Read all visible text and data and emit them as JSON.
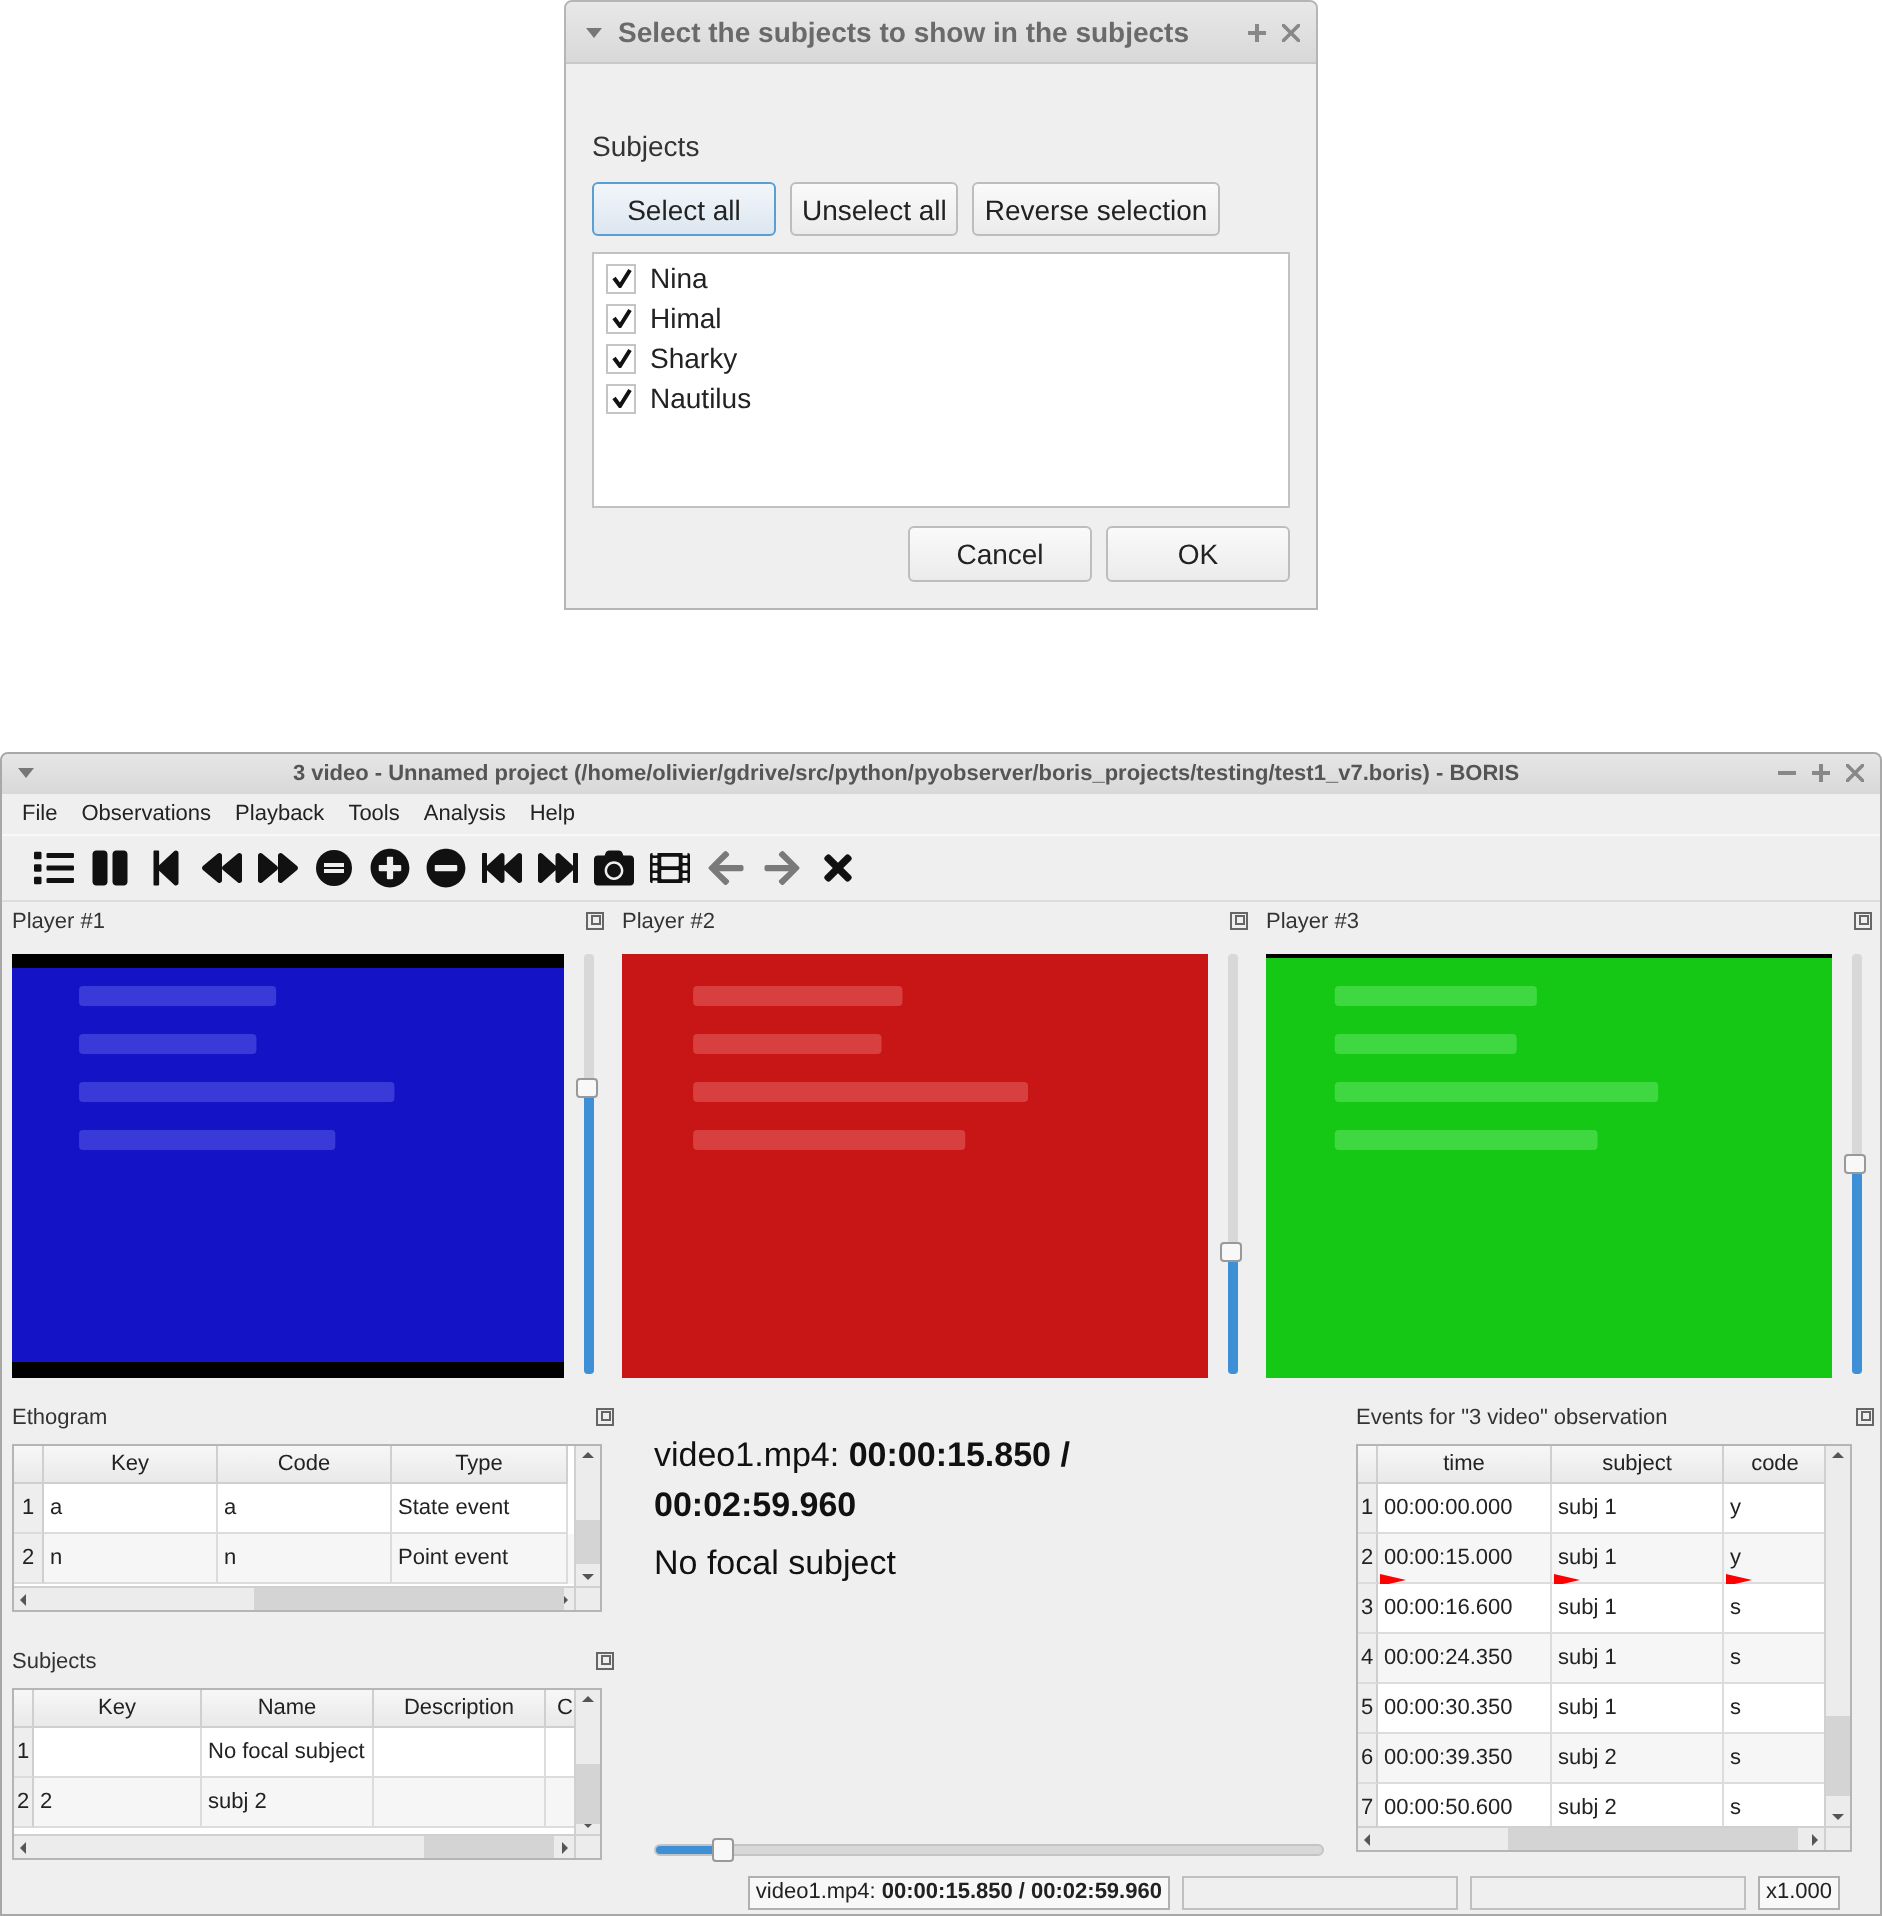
{
  "dialog": {
    "title": "Select the subjects to show in the subjects",
    "section_label": "Subjects",
    "buttons": [
      {
        "label": "Select all",
        "selected": true
      },
      {
        "label": "Unselect all",
        "selected": false
      },
      {
        "label": "Reverse selection",
        "selected": false
      }
    ],
    "subjects": [
      {
        "name": "Nina",
        "checked": true
      },
      {
        "name": "Himal",
        "checked": true
      },
      {
        "name": "Sharky",
        "checked": true
      },
      {
        "name": "Nautilus",
        "checked": true
      }
    ],
    "actions": [
      "Cancel",
      "OK"
    ]
  },
  "window": {
    "title": "3 video - Unnamed project (/home/olivier/gdrive/src/python/pyobserver/boris_projects/testing/test1_v7.boris) - BORIS"
  },
  "menu": [
    "File",
    "Observations",
    "Playback",
    "Tools",
    "Analysis",
    "Help"
  ],
  "toolbar": [
    {
      "kind": "list",
      "disabled": false
    },
    {
      "kind": "pause",
      "disabled": false
    },
    {
      "kind": "step-back",
      "disabled": false
    },
    {
      "kind": "rewind",
      "disabled": false
    },
    {
      "kind": "forward",
      "disabled": false
    },
    {
      "kind": "equals",
      "disabled": false
    },
    {
      "kind": "plus",
      "disabled": false
    },
    {
      "kind": "minus",
      "disabled": false
    },
    {
      "kind": "to-start",
      "disabled": false
    },
    {
      "kind": "to-end",
      "disabled": false
    },
    {
      "kind": "camera",
      "disabled": false
    },
    {
      "kind": "film",
      "disabled": false
    },
    {
      "kind": "left",
      "disabled": true
    },
    {
      "kind": "right",
      "disabled": true
    },
    {
      "kind": "close",
      "disabled": false
    }
  ],
  "players": [
    {
      "title": "Player #1",
      "level": 0.68
    },
    {
      "title": "Player #2",
      "level": 0.29
    },
    {
      "title": "Player #3",
      "level": 0.5
    }
  ],
  "ethogram": {
    "title": "Ethogram",
    "columns": [
      "Key",
      "Code",
      "Type"
    ],
    "rows": [
      {
        "index": "1",
        "cells": [
          "a",
          "a",
          "State event"
        ]
      },
      {
        "index": "2",
        "cells": [
          "n",
          "n",
          "Point event"
        ]
      }
    ]
  },
  "subjects": {
    "title": "Subjects",
    "columns": [
      "Key",
      "Name",
      "Description",
      "C"
    ],
    "rows": [
      {
        "index": "1",
        "cells": [
          null,
          "No focal subject",
          null,
          null
        ]
      },
      {
        "index": "2",
        "cells": [
          "2",
          "subj 2",
          null,
          null
        ]
      }
    ]
  },
  "info": {
    "position": "video1.mp4: **00:00:15.850 / 00:02:59.960**",
    "focal": "No focal subject",
    "level": 0.1
  },
  "events": {
    "title": "Events for \"3 video\" observation",
    "columns": [
      "time",
      "subject",
      "code"
    ],
    "rows": [
      {
        "index": "1",
        "cells": [
          "00:00:00.000",
          "subj 1",
          "y"
        ],
        "marker": false
      },
      {
        "index": "2",
        "cells": [
          "00:00:15.000",
          "subj 1",
          "y"
        ],
        "marker": true
      },
      {
        "index": "3",
        "cells": [
          "00:00:16.600",
          "subj 1",
          "s"
        ],
        "marker": false
      },
      {
        "index": "4",
        "cells": [
          "00:00:24.350",
          "subj 1",
          "s"
        ],
        "marker": false
      },
      {
        "index": "5",
        "cells": [
          "00:00:30.350",
          "subj 1",
          "s"
        ],
        "marker": false
      },
      {
        "index": "6",
        "cells": [
          "00:00:39.350",
          "subj 2",
          "s"
        ],
        "marker": false
      },
      {
        "index": "7",
        "cells": [
          "00:00:50.600",
          "subj 2",
          "s"
        ],
        "marker": false
      }
    ]
  },
  "status_bar": {
    "position": "video1.mp4: **00:00:15.850 / 00:02:59.960**",
    "speed": "x1.000"
  }
}
